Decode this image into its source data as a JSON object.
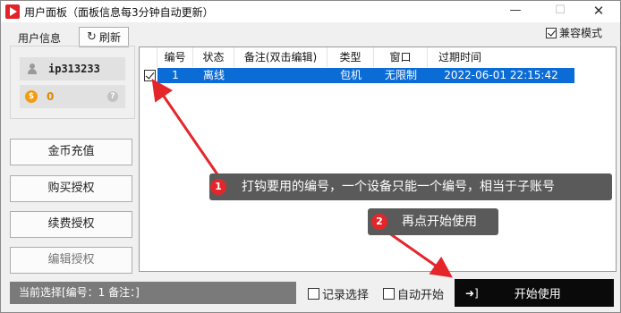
{
  "window": {
    "title": "用户面板（面板信息每3分钟自动更新）",
    "minimize_glyph": "—",
    "maximize_glyph": "☐",
    "close_glyph": "✕"
  },
  "compat_mode": {
    "label": "兼容模式",
    "checked": true
  },
  "user_panel": {
    "heading": "用户信息",
    "refresh_label": "刷新",
    "username": "ip313233",
    "coins": "0",
    "coin_symbol": "$",
    "help_symbol": "?"
  },
  "side_buttons": [
    {
      "label": "金币充值",
      "enabled": true
    },
    {
      "label": "购买授权",
      "enabled": true
    },
    {
      "label": "续费授权",
      "enabled": true
    },
    {
      "label": "编辑授权",
      "enabled": false
    }
  ],
  "table": {
    "columns": [
      "编号",
      "状态",
      "备注(双击编辑)",
      "类型",
      "窗口",
      "过期时间"
    ],
    "rows": [
      {
        "checked": true,
        "selected": true,
        "cells": [
          "1",
          "离线",
          "",
          "包机",
          "无限制",
          "2022-06-01 22:15:42"
        ]
      }
    ]
  },
  "status_bar": {
    "text": "当前选择[编号：1 备注：]"
  },
  "options": {
    "record_selection": {
      "label": "记录选择",
      "checked": false
    },
    "auto_start": {
      "label": "自动开始",
      "checked": false
    }
  },
  "start_button": {
    "label": "开始使用",
    "icon": "login-icon"
  },
  "annotations": [
    {
      "number": "1",
      "text": "打钩要用的编号，一个设备只能一个编号，相当于子账号"
    },
    {
      "number": "2",
      "text": "再点开始使用"
    }
  ],
  "colors": {
    "selection": "#0b6cd6",
    "annotation_bg": "#5a5a5a",
    "badge": "#e4262b",
    "arrow": "#e4262b",
    "coin": "#f39c12",
    "start_button_bg": "#0a0a0a"
  }
}
